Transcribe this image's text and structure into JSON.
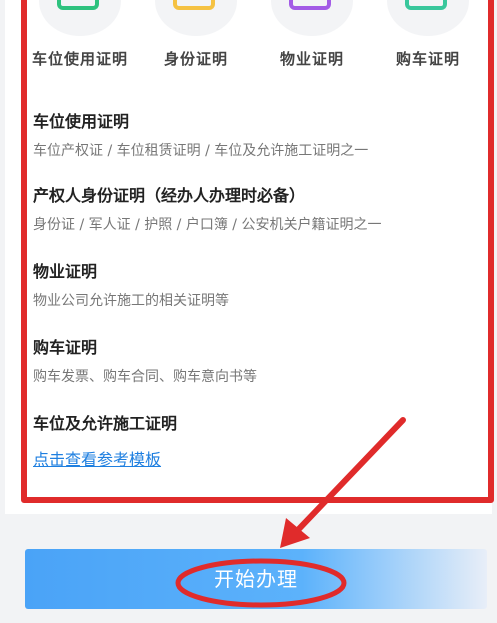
{
  "categories": [
    {
      "label": "车位使用证明",
      "icon": "document-green-icon",
      "color": "#2ec27e"
    },
    {
      "label": "身份证明",
      "icon": "document-yellow-icon",
      "color": "#f5c243"
    },
    {
      "label": "物业证明",
      "icon": "document-purple-icon",
      "color": "#a35be6"
    },
    {
      "label": "购车证明",
      "icon": "document-teal-icon",
      "color": "#39c79c"
    }
  ],
  "sections": [
    {
      "title": "车位使用证明",
      "desc": "车位产权证 / 车位租赁证明 / 车位及允许施工证明之一"
    },
    {
      "title": "产权人身份证明（经办人办理时必备）",
      "desc": "身份证 / 军人证 / 护照 / 户口簿 / 公安机关户籍证明之一"
    },
    {
      "title": "物业证明",
      "desc": "物业公司允许施工的相关证明等"
    },
    {
      "title": "购车证明",
      "desc": "购车发票、购车合同、购车意向书等"
    },
    {
      "title": "车位及允许施工证明",
      "desc": ""
    }
  ],
  "link": {
    "label": "点击查看参考模板"
  },
  "action": {
    "label": "开始办理"
  },
  "colors": {
    "annotation_red": "#e02b2b",
    "link_blue": "#1e7fe0",
    "button_blue": "#4aa3f7"
  }
}
